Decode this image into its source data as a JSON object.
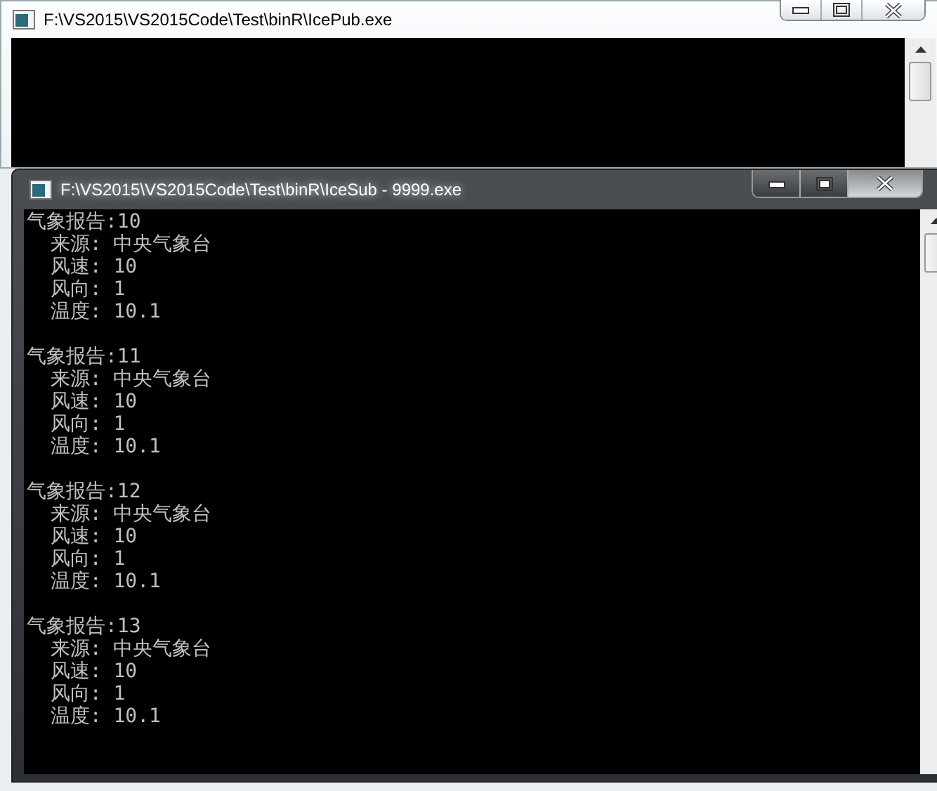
{
  "windows": [
    {
      "title": "F:\\VS2015\\VS2015Code\\Test\\binR\\IcePub.exe",
      "active": false
    },
    {
      "title": "F:\\VS2015\\VS2015Code\\Test\\binR\\IceSub - 9999.exe",
      "active": true,
      "reports": [
        {
          "header": "气象报告:10",
          "lines": [
            "  来源: 中央气象台",
            "  风速: 10",
            "  风向: 1",
            "  温度: 10.1"
          ]
        },
        {
          "header": "气象报告:11",
          "lines": [
            "  来源: 中央气象台",
            "  风速: 10",
            "  风向: 1",
            "  温度: 10.1"
          ]
        },
        {
          "header": "气象报告:12",
          "lines": [
            "  来源: 中央气象台",
            "  风速: 10",
            "  风向: 1",
            "  温度: 10.1"
          ]
        },
        {
          "header": "气象报告:13",
          "lines": [
            "  来源: 中央气象台",
            "  风速: 10",
            "  风向: 1",
            "  温度: 10.1"
          ]
        }
      ]
    }
  ]
}
